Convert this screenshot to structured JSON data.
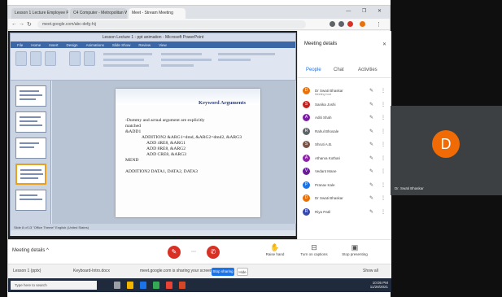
{
  "browser": {
    "tabs": [
      "Lesson 1 Lecture Employee Prac",
      "C4 Computer - Metropolitan Wp",
      "Meet - Stream Meeting"
    ],
    "url": "meet.google.com/abc-defg-hij",
    "window_controls": "— ❐ ✕"
  },
  "ppt": {
    "title": "Lesson Lecture 1 - ppt animation - Microsoft PowerPoint",
    "menu": [
      "File",
      "Home",
      "Insert",
      "Design",
      "Animations",
      "Slide Show",
      "Review",
      "View"
    ],
    "status": "Slide 8 of 13   \"Office Theme\"   English (United States)"
  },
  "slide": {
    "title": "Keyword Arguments",
    "lines": [
      "-Dummy and actual argument are explicitly",
      "matched",
      "&ADD1",
      "ADDITION2 &ARG1=dmd, &ARG2=dmd2, &ARG3",
      "ADD 4RE8, &ARG1",
      "ADD 8RE8, &ARG2",
      "ADD CRE8, &ARG3",
      "MEND",
      "",
      "ADDITION2 DATA1, DATA2, DATA3"
    ]
  },
  "controls": {
    "meeting_details": "Meeting details",
    "caret": "^",
    "mic_icon_label": "✎",
    "leave_icon_label": "✆",
    "mid": "⋯",
    "right": [
      {
        "icon": "✋",
        "label": "Raise hand"
      },
      {
        "icon": "⊟",
        "label": "Turn on captions"
      },
      {
        "icon": "▣",
        "label": "Stop presenting"
      }
    ]
  },
  "sharebar": {
    "left": "Lesson 1 (pptx)",
    "doc": "Keyboard-Intro.docx",
    "sharing": "meet.google.com is sharing your screen",
    "stop": "Stop sharing",
    "hide": "Hide",
    "showall": "Show all"
  },
  "taskbar": {
    "search": "Type here to search",
    "time": "10:05 PM",
    "date": "11/28/2021"
  },
  "side": {
    "title": "Meeting details",
    "close": "✕",
    "tabs": [
      "People",
      "Chat",
      "Activities"
    ],
    "people": [
      {
        "initial": "D",
        "name": "Dr Swati Bhaskar",
        "sub": "Meeting host",
        "color": "#e8710a"
      },
      {
        "initial": "S",
        "name": "Sanika Joshi",
        "sub": "",
        "color": "#c5221f"
      },
      {
        "initial": "A",
        "name": "Aditi Shah",
        "sub": "",
        "color": "#7b1fa2"
      },
      {
        "initial": "R",
        "name": "Rahul Bhosale",
        "sub": "",
        "color": "#5f6368"
      },
      {
        "initial": "S",
        "name": "Shruti A.B.",
        "sub": "",
        "color": "#795548"
      },
      {
        "initial": "A",
        "name": "Atharva Kothari",
        "sub": "",
        "color": "#8e24aa"
      },
      {
        "initial": "V",
        "name": "Vedant Mane",
        "sub": "",
        "color": "#6a1b9a"
      },
      {
        "initial": "P",
        "name": "Pranav Kale",
        "sub": "",
        "color": "#1a73e8"
      },
      {
        "initial": "D",
        "name": "Dr Swati Bhaskar",
        "sub": "",
        "color": "#e8710a"
      },
      {
        "initial": "R",
        "name": "Riya Patil",
        "sub": "",
        "color": "#3949ab"
      }
    ]
  },
  "tile": {
    "initial": "D",
    "name": "Dr. Swati Bhaskar"
  }
}
